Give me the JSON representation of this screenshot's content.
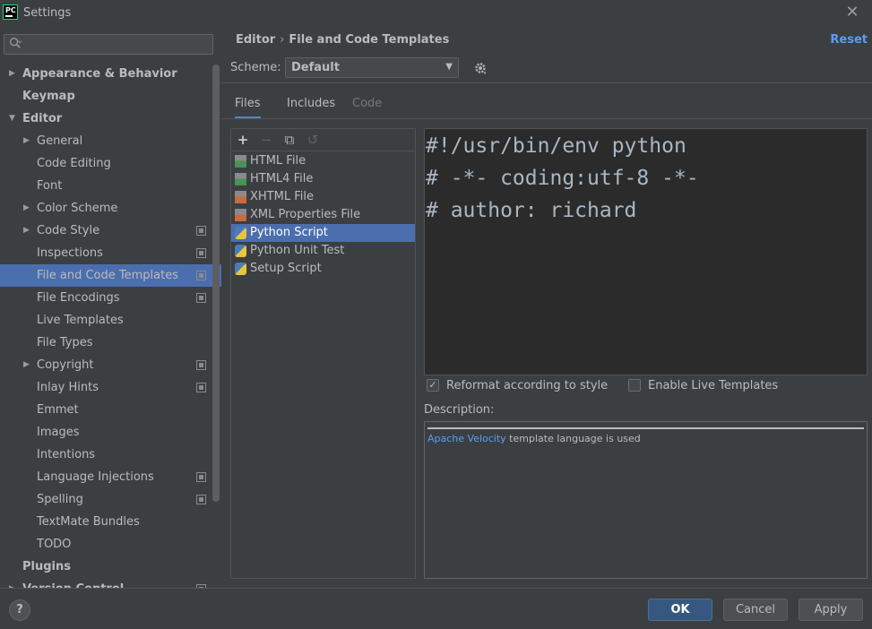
{
  "window": {
    "app_icon_text": "PC",
    "title": "Settings",
    "close_glyph": "✕"
  },
  "search": {
    "placeholder": ""
  },
  "sidebar": {
    "items": [
      {
        "label": "Appearance & Behavior",
        "level": 0,
        "bold": true,
        "arrow": "▶",
        "project": false,
        "selected": false
      },
      {
        "label": "Keymap",
        "level": 0,
        "bold": true,
        "arrow": "",
        "project": false,
        "selected": false
      },
      {
        "label": "Editor",
        "level": 0,
        "bold": true,
        "arrow": "▼",
        "project": false,
        "selected": false
      },
      {
        "label": "General",
        "level": 1,
        "bold": false,
        "arrow": "▶",
        "project": false,
        "selected": false
      },
      {
        "label": "Code Editing",
        "level": 1,
        "bold": false,
        "arrow": "",
        "project": false,
        "selected": false
      },
      {
        "label": "Font",
        "level": 1,
        "bold": false,
        "arrow": "",
        "project": false,
        "selected": false
      },
      {
        "label": "Color Scheme",
        "level": 1,
        "bold": false,
        "arrow": "▶",
        "project": false,
        "selected": false
      },
      {
        "label": "Code Style",
        "level": 1,
        "bold": false,
        "arrow": "▶",
        "project": true,
        "selected": false
      },
      {
        "label": "Inspections",
        "level": 1,
        "bold": false,
        "arrow": "",
        "project": true,
        "selected": false
      },
      {
        "label": "File and Code Templates",
        "level": 1,
        "bold": false,
        "arrow": "",
        "project": true,
        "selected": true
      },
      {
        "label": "File Encodings",
        "level": 1,
        "bold": false,
        "arrow": "",
        "project": true,
        "selected": false
      },
      {
        "label": "Live Templates",
        "level": 1,
        "bold": false,
        "arrow": "",
        "project": false,
        "selected": false
      },
      {
        "label": "File Types",
        "level": 1,
        "bold": false,
        "arrow": "",
        "project": false,
        "selected": false
      },
      {
        "label": "Copyright",
        "level": 1,
        "bold": false,
        "arrow": "▶",
        "project": true,
        "selected": false
      },
      {
        "label": "Inlay Hints",
        "level": 1,
        "bold": false,
        "arrow": "",
        "project": true,
        "selected": false
      },
      {
        "label": "Emmet",
        "level": 1,
        "bold": false,
        "arrow": "",
        "project": false,
        "selected": false
      },
      {
        "label": "Images",
        "level": 1,
        "bold": false,
        "arrow": "",
        "project": false,
        "selected": false
      },
      {
        "label": "Intentions",
        "level": 1,
        "bold": false,
        "arrow": "",
        "project": false,
        "selected": false
      },
      {
        "label": "Language Injections",
        "level": 1,
        "bold": false,
        "arrow": "",
        "project": true,
        "selected": false
      },
      {
        "label": "Spelling",
        "level": 1,
        "bold": false,
        "arrow": "",
        "project": true,
        "selected": false
      },
      {
        "label": "TextMate Bundles",
        "level": 1,
        "bold": false,
        "arrow": "",
        "project": false,
        "selected": false
      },
      {
        "label": "TODO",
        "level": 1,
        "bold": false,
        "arrow": "",
        "project": false,
        "selected": false
      },
      {
        "label": "Plugins",
        "level": 0,
        "bold": true,
        "arrow": "",
        "project": false,
        "selected": false
      },
      {
        "label": "Version Control",
        "level": 0,
        "bold": true,
        "arrow": "▶",
        "project": true,
        "selected": false
      }
    ]
  },
  "header": {
    "breadcrumb_parent": "Editor",
    "breadcrumb_separator": "›",
    "breadcrumb_current": "File and Code Templates",
    "reset_label": "Reset"
  },
  "scheme": {
    "label": "Scheme:",
    "value": "Default"
  },
  "tabs": [
    {
      "label": "Files",
      "state": "active"
    },
    {
      "label": "Includes",
      "state": "normal"
    },
    {
      "label": "Code",
      "state": "disabled"
    }
  ],
  "toolbar": {
    "add": "+",
    "remove": "−",
    "copy": "⧉",
    "reset": "↺"
  },
  "templates": [
    {
      "label": "HTML File",
      "icon": "html-file-icon",
      "kind": "html",
      "selected": false
    },
    {
      "label": "HTML4 File",
      "icon": "html4-file-icon",
      "kind": "html",
      "selected": false
    },
    {
      "label": "XHTML File",
      "icon": "xhtml-file-icon",
      "kind": "xhtml",
      "selected": false
    },
    {
      "label": "XML Properties File",
      "icon": "xml-file-icon",
      "kind": "xml",
      "selected": false
    },
    {
      "label": "Python Script",
      "icon": "python-file-icon",
      "kind": "py",
      "selected": true
    },
    {
      "label": "Python Unit Test",
      "icon": "python-file-icon",
      "kind": "py",
      "selected": false
    },
    {
      "label": "Setup Script",
      "icon": "python-file-icon",
      "kind": "py",
      "selected": false
    }
  ],
  "editor": {
    "lines": [
      "#!/usr/bin/env python",
      "# -*- coding:utf-8 -*-",
      "# author: richard"
    ]
  },
  "options": {
    "reformat": {
      "label": "Reformat according to style",
      "checked": true
    },
    "live_templates": {
      "label": "Enable Live Templates",
      "checked": false
    }
  },
  "description": {
    "label": "Description:",
    "link_text": "Apache Velocity",
    "rest_text": " template language is used"
  },
  "buttons": {
    "help": "?",
    "ok": "OK",
    "cancel": "Cancel",
    "apply": "Apply"
  }
}
